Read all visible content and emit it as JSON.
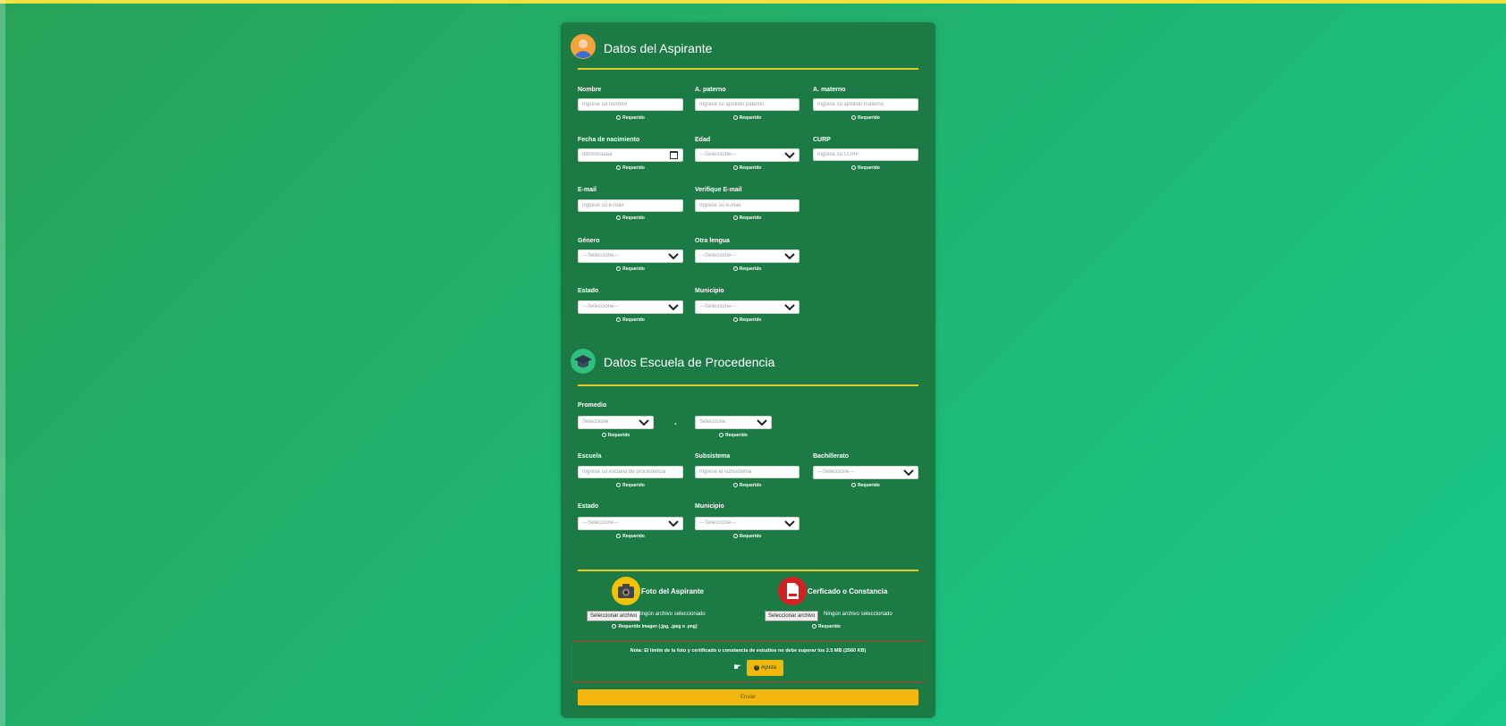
{
  "aspirante": {
    "title": "Datos del Aspirante",
    "nombre": {
      "label": "Nombre",
      "placeholder": "Ingrese su nombre",
      "req": "Requerido"
    },
    "paterno": {
      "label": "A. paterno",
      "placeholder": "Ingrese su apellido paterno",
      "req": "Requerido"
    },
    "materno": {
      "label": "A. materno",
      "placeholder": "Ingrese su apellido materno",
      "req": "Requerido"
    },
    "fecha": {
      "label": "Fecha de nacimiento",
      "value": "dd/mm/aaaa",
      "req": "Requerido"
    },
    "edad": {
      "label": "Edad",
      "value": "---Seleccione---",
      "req": "Requerido"
    },
    "curp": {
      "label": "CURP",
      "placeholder": "Ingrese su CURP",
      "req": "Requerido"
    },
    "email": {
      "label": "E-mail",
      "placeholder": "Ingrese su e-mail",
      "req": "Requerido"
    },
    "email2": {
      "label": "Verifique E-mail",
      "placeholder": "Ingrese su e-mail",
      "req": "Requerido"
    },
    "genero": {
      "label": "Género",
      "value": "---Seleccione---",
      "req": "Requerido"
    },
    "lengua": {
      "label": "Otra lengua",
      "value": "---Seleccione---",
      "req": "Requerido"
    },
    "estado": {
      "label": "Estado",
      "value": "---Seleccione---",
      "req": "Requerido"
    },
    "municipio": {
      "label": "Municipio",
      "value": "---Seleccione---",
      "req": "Requerido"
    }
  },
  "escuela": {
    "title": "Datos Escuela de Procedencia",
    "promedio": {
      "label": "Promedio",
      "entero": "Seleccione",
      "decimal": "Seleccione",
      "req": "Requerido",
      "separator": "."
    },
    "escuela": {
      "label": "Escuela",
      "placeholder": "Ingrese su escuela de procedencia",
      "req": "Requerido"
    },
    "subsistema": {
      "label": "Subsistema",
      "placeholder": "Ingrese el subsistema",
      "req": "Requerido"
    },
    "bachillerato": {
      "label": "Bachillerato",
      "value": "---Seleccione---",
      "req": "Requerido"
    },
    "estado": {
      "label": "Estado",
      "value": "---Seleccione---",
      "req": "Requerido"
    },
    "municipio": {
      "label": "Municipio",
      "value": "---Seleccione---",
      "req": "Requerido"
    }
  },
  "archivos": {
    "foto": {
      "title": "Foto del Aspirante",
      "button": "Seleccionar archivo",
      "status": "Ningún archivo seleccionado",
      "req": "Requerido Imagen (.jpg, .jpeg o .png)"
    },
    "certificado": {
      "title": "Cerficado o Constancia",
      "button": "Seleccionar archivo",
      "status": "Ningún archivo seleccionado",
      "req": "Requerido"
    }
  },
  "nota": {
    "text": "Nota: El límite de la foto y certificado o constancia de estudios no debe superar los 2.5 MB (2560 KB)",
    "help": "Ayuda"
  },
  "submit": "Enviar",
  "colors": {
    "card": "#1c7a44",
    "accent_line": "#e8c92a",
    "button": "#f5b60d",
    "note_border": "#c0392b"
  }
}
